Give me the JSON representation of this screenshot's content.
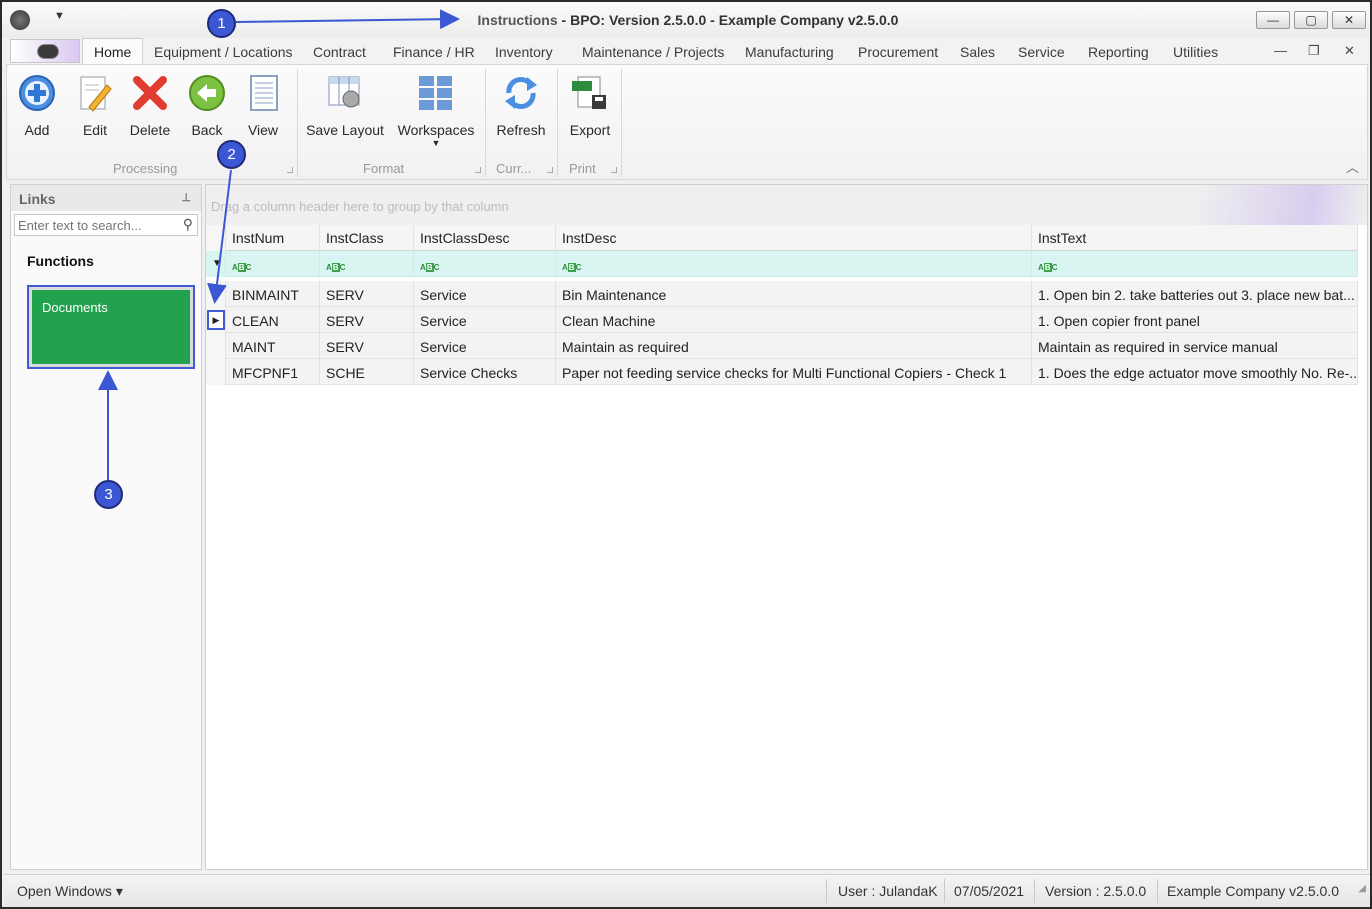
{
  "window": {
    "title_prefix": "Instructions",
    "title_rest": " - BPO: Version 2.5.0.0 - Example Company v2.5.0.0",
    "minimize": "—",
    "maximize": "▢",
    "close": "✕"
  },
  "tabs": [
    {
      "label": "Home"
    },
    {
      "label": "Equipment / Locations"
    },
    {
      "label": "Contract"
    },
    {
      "label": "Finance / HR"
    },
    {
      "label": "Inventory"
    },
    {
      "label": "Maintenance / Projects"
    },
    {
      "label": "Manufacturing"
    },
    {
      "label": "Procurement"
    },
    {
      "label": "Sales"
    },
    {
      "label": "Service"
    },
    {
      "label": "Reporting"
    },
    {
      "label": "Utilities"
    }
  ],
  "ribbon": {
    "buttons": {
      "add": "Add",
      "edit": "Edit",
      "delete": "Delete",
      "back": "Back",
      "view": "View",
      "save_layout": "Save Layout",
      "workspaces": "Workspaces",
      "refresh": "Refresh",
      "export": "Export"
    },
    "groups": {
      "processing": "Processing",
      "format": "Format",
      "current": "Curr...",
      "print": "Print"
    }
  },
  "links": {
    "title": "Links",
    "search_placeholder": "Enter text to search...",
    "functions_heading": "Functions",
    "tiles": [
      {
        "label": "Documents",
        "color": "#22a24c"
      }
    ]
  },
  "grid": {
    "group_hint": "Drag a column header here to group by that column",
    "columns": [
      "InstNum",
      "InstClass",
      "InstClassDesc",
      "InstDesc",
      "InstText"
    ],
    "rows": [
      [
        "BINMAINT",
        "SERV",
        "Service",
        "Bin Maintenance",
        "1. Open bin 2. take batteries out 3. place new bat..."
      ],
      [
        "CLEAN",
        "SERV",
        "Service",
        "Clean Machine",
        "1. Open copier front panel"
      ],
      [
        "MAINT",
        "SERV",
        "Service",
        "Maintain as required",
        "Maintain as required in service manual"
      ],
      [
        "MFCPNF1",
        "SCHE",
        "Service Checks",
        "Paper not feeding service checks for Multi Functional Copiers - Check 1",
        "1. Does the edge actuator move smoothly No. Re-..."
      ]
    ]
  },
  "status": {
    "open_windows": "Open Windows",
    "user": "User : JulandaK",
    "date": "07/05/2021",
    "version": "Version : 2.5.0.0",
    "company": "Example Company v2.5.0.0"
  },
  "annotations": {
    "c1": "1",
    "c2": "2",
    "c3": "3",
    "color": "#3b57d4"
  }
}
